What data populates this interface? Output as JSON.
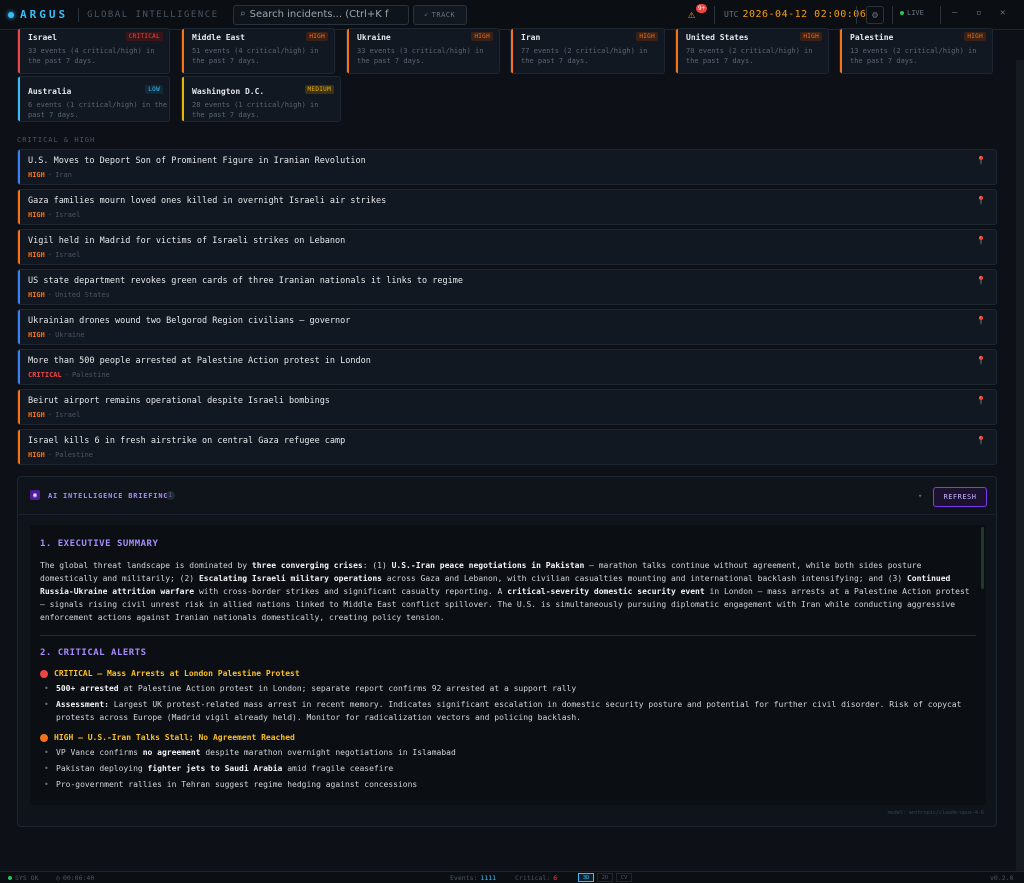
{
  "app": {
    "name": "ARGUS",
    "tagline": "GLOBAL INTELLIGENCE",
    "search_placeholder": "Search incidents... (Ctrl+K f",
    "track_label": "TRACK",
    "alert_count": "9+",
    "utc_label": "UTC",
    "clock": "2026-04-12 02:00:06",
    "live_label": "LIVE",
    "accent": "#38bdf8"
  },
  "regions": [
    {
      "name": "Israel",
      "badge": "CRITICAL",
      "level": "critical",
      "desc": "33 events (4 critical/high) in the past 7 days."
    },
    {
      "name": "Middle East",
      "badge": "HIGH",
      "level": "high",
      "desc": "51 events (4 critical/high) in the past 7 days."
    },
    {
      "name": "Ukraine",
      "badge": "HIGH",
      "level": "high",
      "desc": "33 events (3 critical/high) in the past 7 days."
    },
    {
      "name": "Iran",
      "badge": "HIGH",
      "level": "high",
      "desc": "77 events (2 critical/high) in the past 7 days."
    },
    {
      "name": "United States",
      "badge": "HIGH",
      "level": "high",
      "desc": "70 events (2 critical/high) in the past 7 days."
    },
    {
      "name": "Palestine",
      "badge": "HIGH",
      "level": "high",
      "desc": "13 events (2 critical/high) in the past 7 days."
    },
    {
      "name": "Australia",
      "badge": "LOW",
      "level": "low",
      "desc": "6 events (1 critical/high) in the past 7 days."
    },
    {
      "name": "Washington D.C.",
      "badge": "MEDIUM",
      "level": "medium",
      "desc": "28 events (1 critical/high) in the past 7 days."
    }
  ],
  "section_label": "CRITICAL & HIGH",
  "incidents": [
    {
      "title": "U.S. Moves to Deport Son of Prominent Figure in Iranian Revolution",
      "severity": "HIGH",
      "location": "Iran"
    },
    {
      "title": "Gaza families mourn loved ones killed in overnight Israeli air strikes",
      "severity": "HIGH",
      "location": "Israel"
    },
    {
      "title": "Vigil held in Madrid for victims of Israeli strikes on Lebanon",
      "severity": "HIGH",
      "location": "Israel"
    },
    {
      "title": "US state department revokes green cards of three Iranian nationals it links to regime",
      "severity": "HIGH",
      "location": "United States"
    },
    {
      "title": "Ukrainian drones wound two Belgorod Region civilians — governor",
      "severity": "HIGH",
      "location": "Ukraine"
    },
    {
      "title": "More than 500 people arrested at Palestine Action protest in London",
      "severity": "CRITICAL",
      "location": "Palestine"
    },
    {
      "title": "Beirut airport remains operational despite Israeli bombings",
      "severity": "HIGH",
      "location": "Israel"
    },
    {
      "title": "Israel kills 6 in fresh airstrike on central Gaza refugee camp",
      "severity": "HIGH",
      "location": "Palestine"
    }
  ],
  "briefing": {
    "title": "AI INTELLIGENCE BRIEFING",
    "refresh_label": "REFRESH",
    "sec1_title": "1. EXECUTIVE SUMMARY",
    "sec2_title": "2. CRITICAL ALERTS",
    "alert1_title": "CRITICAL — Mass Arrests at London Palestine Protest",
    "alert2_title": "HIGH — U.S.-Iran Talks Stall; No Agreement Reached",
    "model": "model: anthropic/claude-opus-4-6"
  },
  "status": {
    "sys_ok": "SYS OK",
    "uptime": "00:06:40",
    "events_label": "Events:",
    "events_value": "1111",
    "critical_label": "Critical:",
    "critical_value": "6",
    "btn_2d": "3D",
    "btn_cv": "CV",
    "btn_2d_alt": "2D",
    "version": "v0.2.0"
  }
}
